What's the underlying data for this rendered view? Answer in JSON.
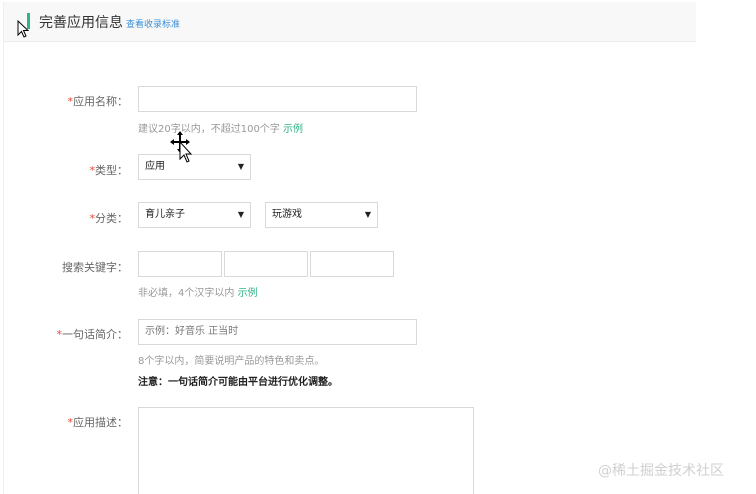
{
  "header": {
    "title": "完善应用信息",
    "link": "查看收录标准"
  },
  "required_mark": "*",
  "app_name": {
    "label": "应用名称：",
    "value": "",
    "hint": "建议20字以内，不超过100个字",
    "example": "示例"
  },
  "type": {
    "label": "类型：",
    "selected": "应用"
  },
  "category": {
    "label": "分类：",
    "primary": "育儿亲子",
    "secondary": "玩游戏"
  },
  "keywords": {
    "label": "搜索关键字：",
    "hint": "非必填，4个汉字以内",
    "example": "示例"
  },
  "tagline": {
    "label": "一句话简介：",
    "placeholder": "示例：好音乐 正当时",
    "hint": "8个字以内，简要说明产品的特色和卖点。",
    "note": "注意：一句话简介可能由平台进行优化调整。"
  },
  "description": {
    "label": "应用描述："
  },
  "watermark": "@稀土掘金技术社区",
  "icons": {
    "arrow": "▼",
    "cursor": "arrow-cursor",
    "move": "move-cursor"
  }
}
